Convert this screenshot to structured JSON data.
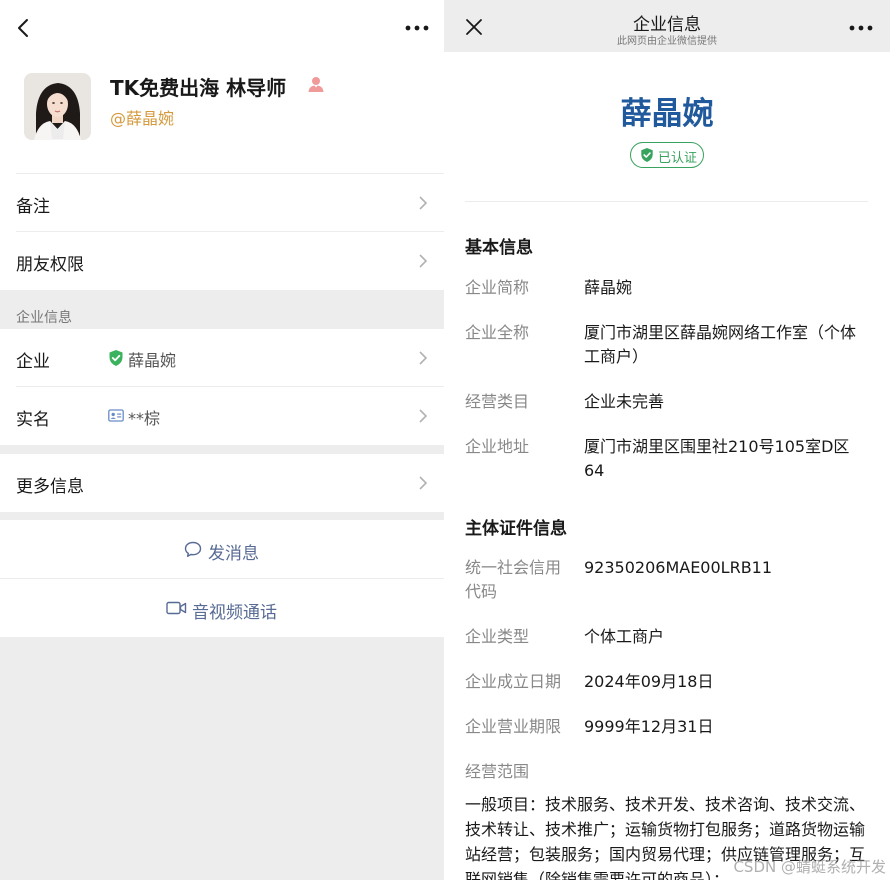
{
  "profile": {
    "name": "TK免费出海 林导师",
    "id_text": "@薛晶婉"
  },
  "settings": {
    "remark_label": "备注",
    "permission_label": "朋友权限"
  },
  "enterprise": {
    "section_label": "企业信息",
    "company_label": "企业",
    "company_value": "薛晶婉",
    "realname_label": "实名",
    "realname_value": "**棕"
  },
  "more": {
    "label": "更多信息"
  },
  "actions": {
    "message_label": "发消息",
    "call_label": "音视频通话"
  },
  "detail": {
    "title": "企业信息",
    "subtitle": "此网页由企业微信提供",
    "company_name": "薛晶婉",
    "verified_label": "已认证",
    "basic_section": "基本信息",
    "basic": [
      {
        "key": "企业简称",
        "value": "薛晶婉"
      },
      {
        "key": "企业全称",
        "value": "厦门市湖里区薛晶婉网络工作室（个体工商户）"
      },
      {
        "key": "经营类目",
        "value": "企业未完善"
      },
      {
        "key": "企业地址",
        "value": "厦门市湖里区围里社210号105室D区64"
      }
    ],
    "cert_section": "主体证件信息",
    "cert": [
      {
        "key": "统一社会信用代码",
        "value": "92350206MAE00LRB11"
      },
      {
        "key": "企业类型",
        "value": "个体工商户"
      },
      {
        "key": "企业成立日期",
        "value": "2024年09月18日"
      },
      {
        "key": "企业营业期限",
        "value": "9999年12月31日"
      }
    ],
    "scope_label": "经营范围",
    "scope_text": "一般项目：技术服务、技术开发、技术咨询、技术交流、技术转让、技术推广；运输货物打包服务；道路货物运输站经营；包装服务；国内贸易代理；供应链管理服务；互联网销售（除销售需要许可的商品）；"
  },
  "watermark": "CSDN @蜻蜓系统开发",
  "colors": {
    "link_blue": "#576b95",
    "company_blue": "#205a9c",
    "verified_green": "#37a35e",
    "id_orange": "#d49a3d"
  },
  "icons": [
    "back-arrow-icon",
    "more-dots-icon",
    "female-user-icon",
    "chevron-right-icon",
    "shield-check-icon",
    "id-card-icon",
    "chat-bubble-icon",
    "video-camera-icon",
    "close-icon"
  ]
}
